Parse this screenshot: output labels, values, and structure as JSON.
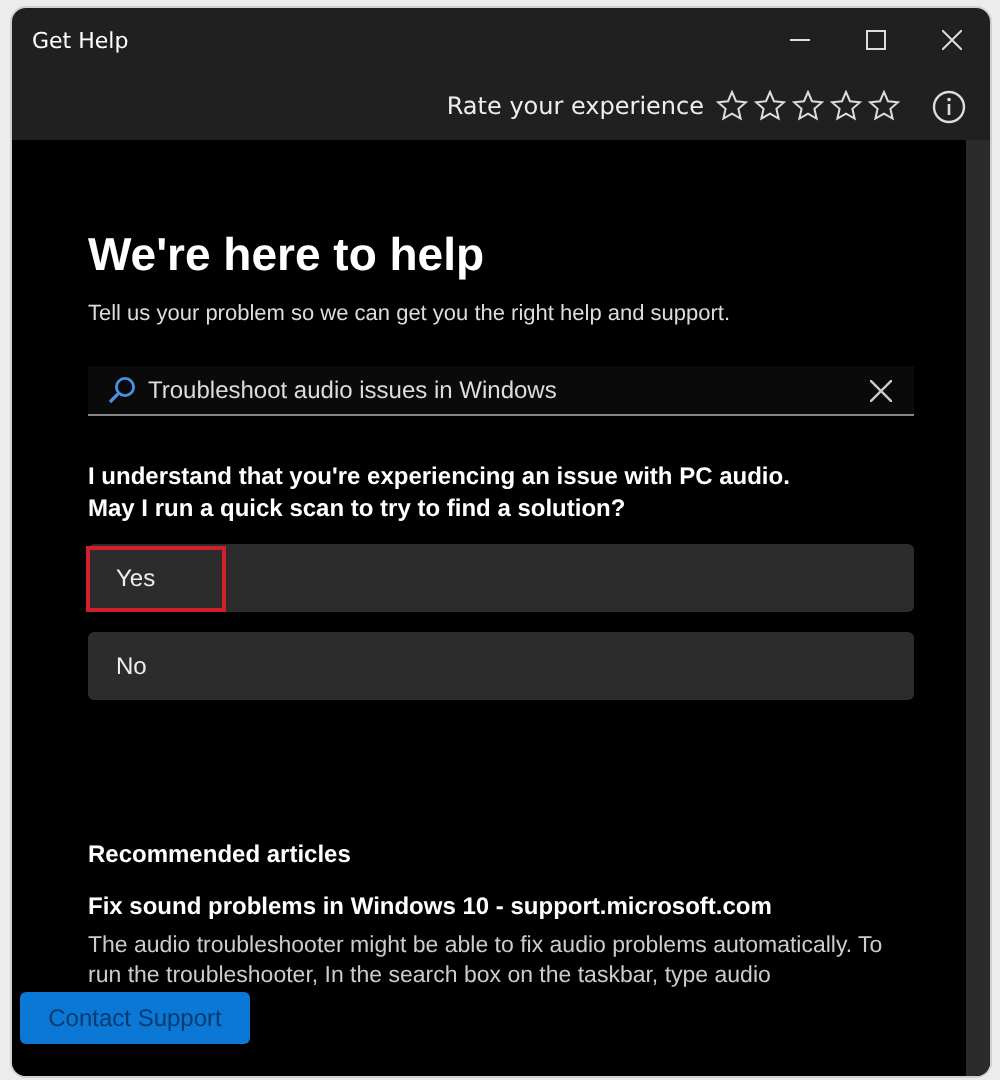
{
  "window": {
    "title": "Get Help"
  },
  "rating": {
    "label": "Rate your experience",
    "stars": 0
  },
  "heading": "We're here to help",
  "subheading": "Tell us your problem so we can get you the right help and support.",
  "search": {
    "value": "Troubleshoot audio issues in Windows"
  },
  "question": [
    "I understand that you're experiencing an issue with PC audio.",
    "May I run a quick scan to try to find a solution?"
  ],
  "options": [
    {
      "label": "Yes",
      "highlighted": true
    },
    {
      "label": "No",
      "highlighted": false
    }
  ],
  "articles": {
    "title": "Recommended articles",
    "items": [
      {
        "title": "Fix sound problems in Windows 10 - support.microsoft.com",
        "snippet": "The audio troubleshooter might be able to fix audio problems automatically. To run the troubleshooter, In the search box on the taskbar, type audio"
      }
    ]
  },
  "contact_button": "Contact Support"
}
